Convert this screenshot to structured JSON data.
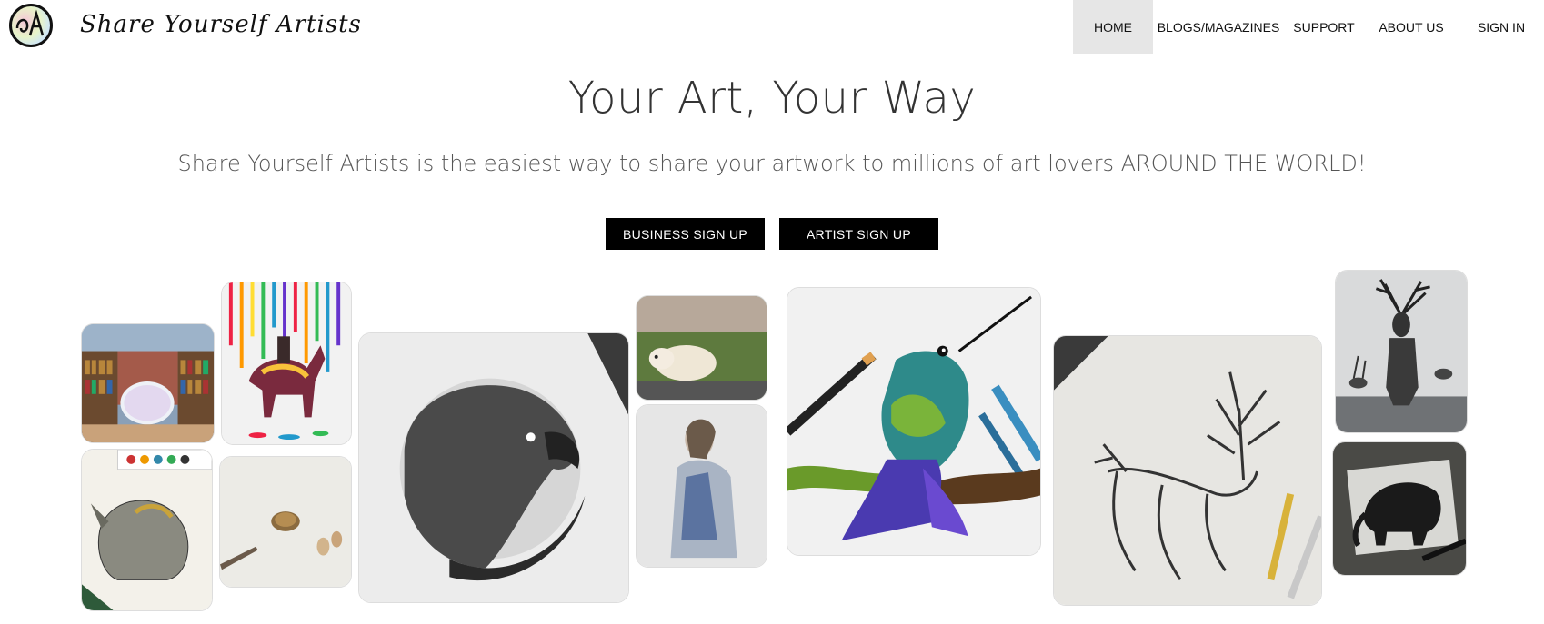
{
  "header": {
    "logo_icon": "artist-monogram-logo",
    "brand": "Share Yourself Artists",
    "nav": [
      {
        "label": "HOME",
        "active": true
      },
      {
        "label": "BLOGS/MAGAZINES",
        "active": false
      },
      {
        "label": "SUPPORT",
        "active": false
      },
      {
        "label": "ABOUT US",
        "active": false
      },
      {
        "label": "SIGN IN",
        "active": false
      }
    ]
  },
  "hero": {
    "title": "Your Art, Your Way",
    "subtitle": "Share Yourself Artists is the easiest way to share your artwork to millions of art lovers AROUND THE WORLD!",
    "buttons": {
      "business": "BUSINESS SIGN UP",
      "artist": "ARTIST SIGN UP"
    }
  },
  "colors": {
    "button_bg": "#000000",
    "button_text": "#ffffff",
    "nav_active_bg": "#e6e6e6"
  },
  "gallery": [
    {
      "name": "library-painting"
    },
    {
      "name": "unicorn-painting"
    },
    {
      "name": "rhino-sketch"
    },
    {
      "name": "turtle-painting"
    },
    {
      "name": "eagle-stipple-drawing"
    },
    {
      "name": "polar-bear-mural"
    },
    {
      "name": "woman-pencil-drawing"
    },
    {
      "name": "hummingbird-drawing"
    },
    {
      "name": "tree-deer-drawing"
    },
    {
      "name": "deer-man-drawing"
    },
    {
      "name": "elephant-ink-drawing"
    }
  ]
}
